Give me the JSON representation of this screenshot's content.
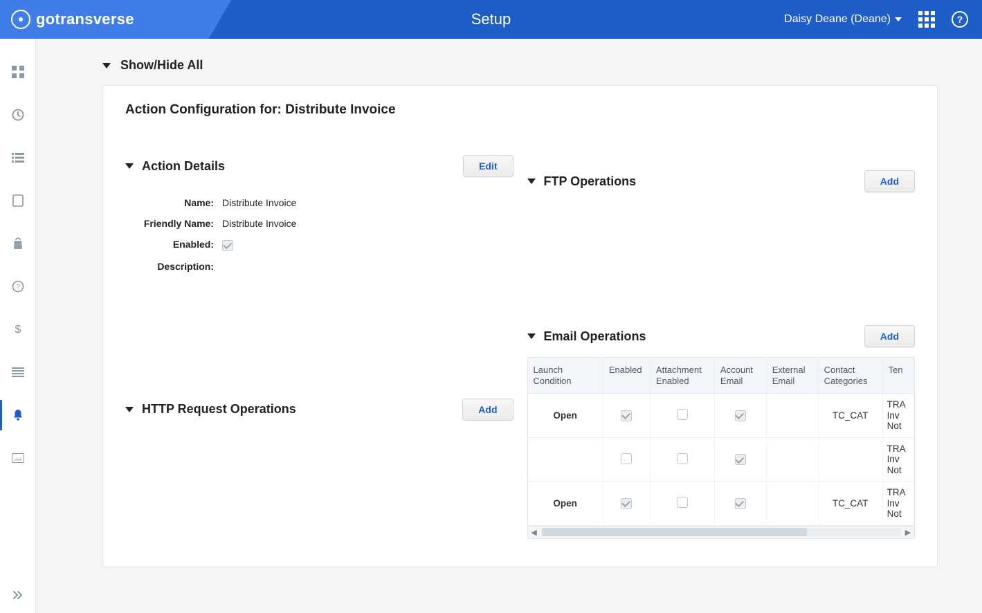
{
  "header": {
    "brand": "gotransverse",
    "title": "Setup",
    "user_label": "Daisy Deane (Deane)"
  },
  "content": {
    "showhide_label": "Show/Hide All",
    "page_title": "Action Configuration for: Distribute Invoice",
    "action_details": {
      "heading": "Action Details",
      "edit_btn": "Edit",
      "rows": {
        "name_k": "Name:",
        "name_v": "Distribute Invoice",
        "friendly_k": "Friendly Name:",
        "friendly_v": "Distribute Invoice",
        "enabled_k": "Enabled:",
        "desc_k": "Description:"
      }
    },
    "http_ops": {
      "heading": "HTTP Request Operations",
      "add_btn": "Add"
    },
    "ftp_ops": {
      "heading": "FTP Operations",
      "add_btn": "Add"
    },
    "email_ops": {
      "heading": "Email Operations",
      "add_btn": "Add",
      "columns": {
        "c0": "Launch Condition",
        "c1": "Enabled",
        "c2": "Attachment Enabled",
        "c3": "Account Email",
        "c4": "External Email",
        "c5": "Contact Categories",
        "c6": "Ten"
      },
      "rows": [
        {
          "launch": "Open",
          "enabled": true,
          "attach": false,
          "acct": true,
          "ext": "",
          "cats": "TC_CAT",
          "tpl": "TRA Inv Not"
        },
        {
          "launch": "",
          "enabled": false,
          "attach": false,
          "acct": true,
          "ext": "",
          "cats": "",
          "tpl": "TRA Inv Not"
        },
        {
          "launch": "Open",
          "enabled": true,
          "attach": false,
          "acct": true,
          "ext": "",
          "cats": "TC_CAT",
          "tpl": "TRA Inv Not"
        }
      ]
    }
  }
}
